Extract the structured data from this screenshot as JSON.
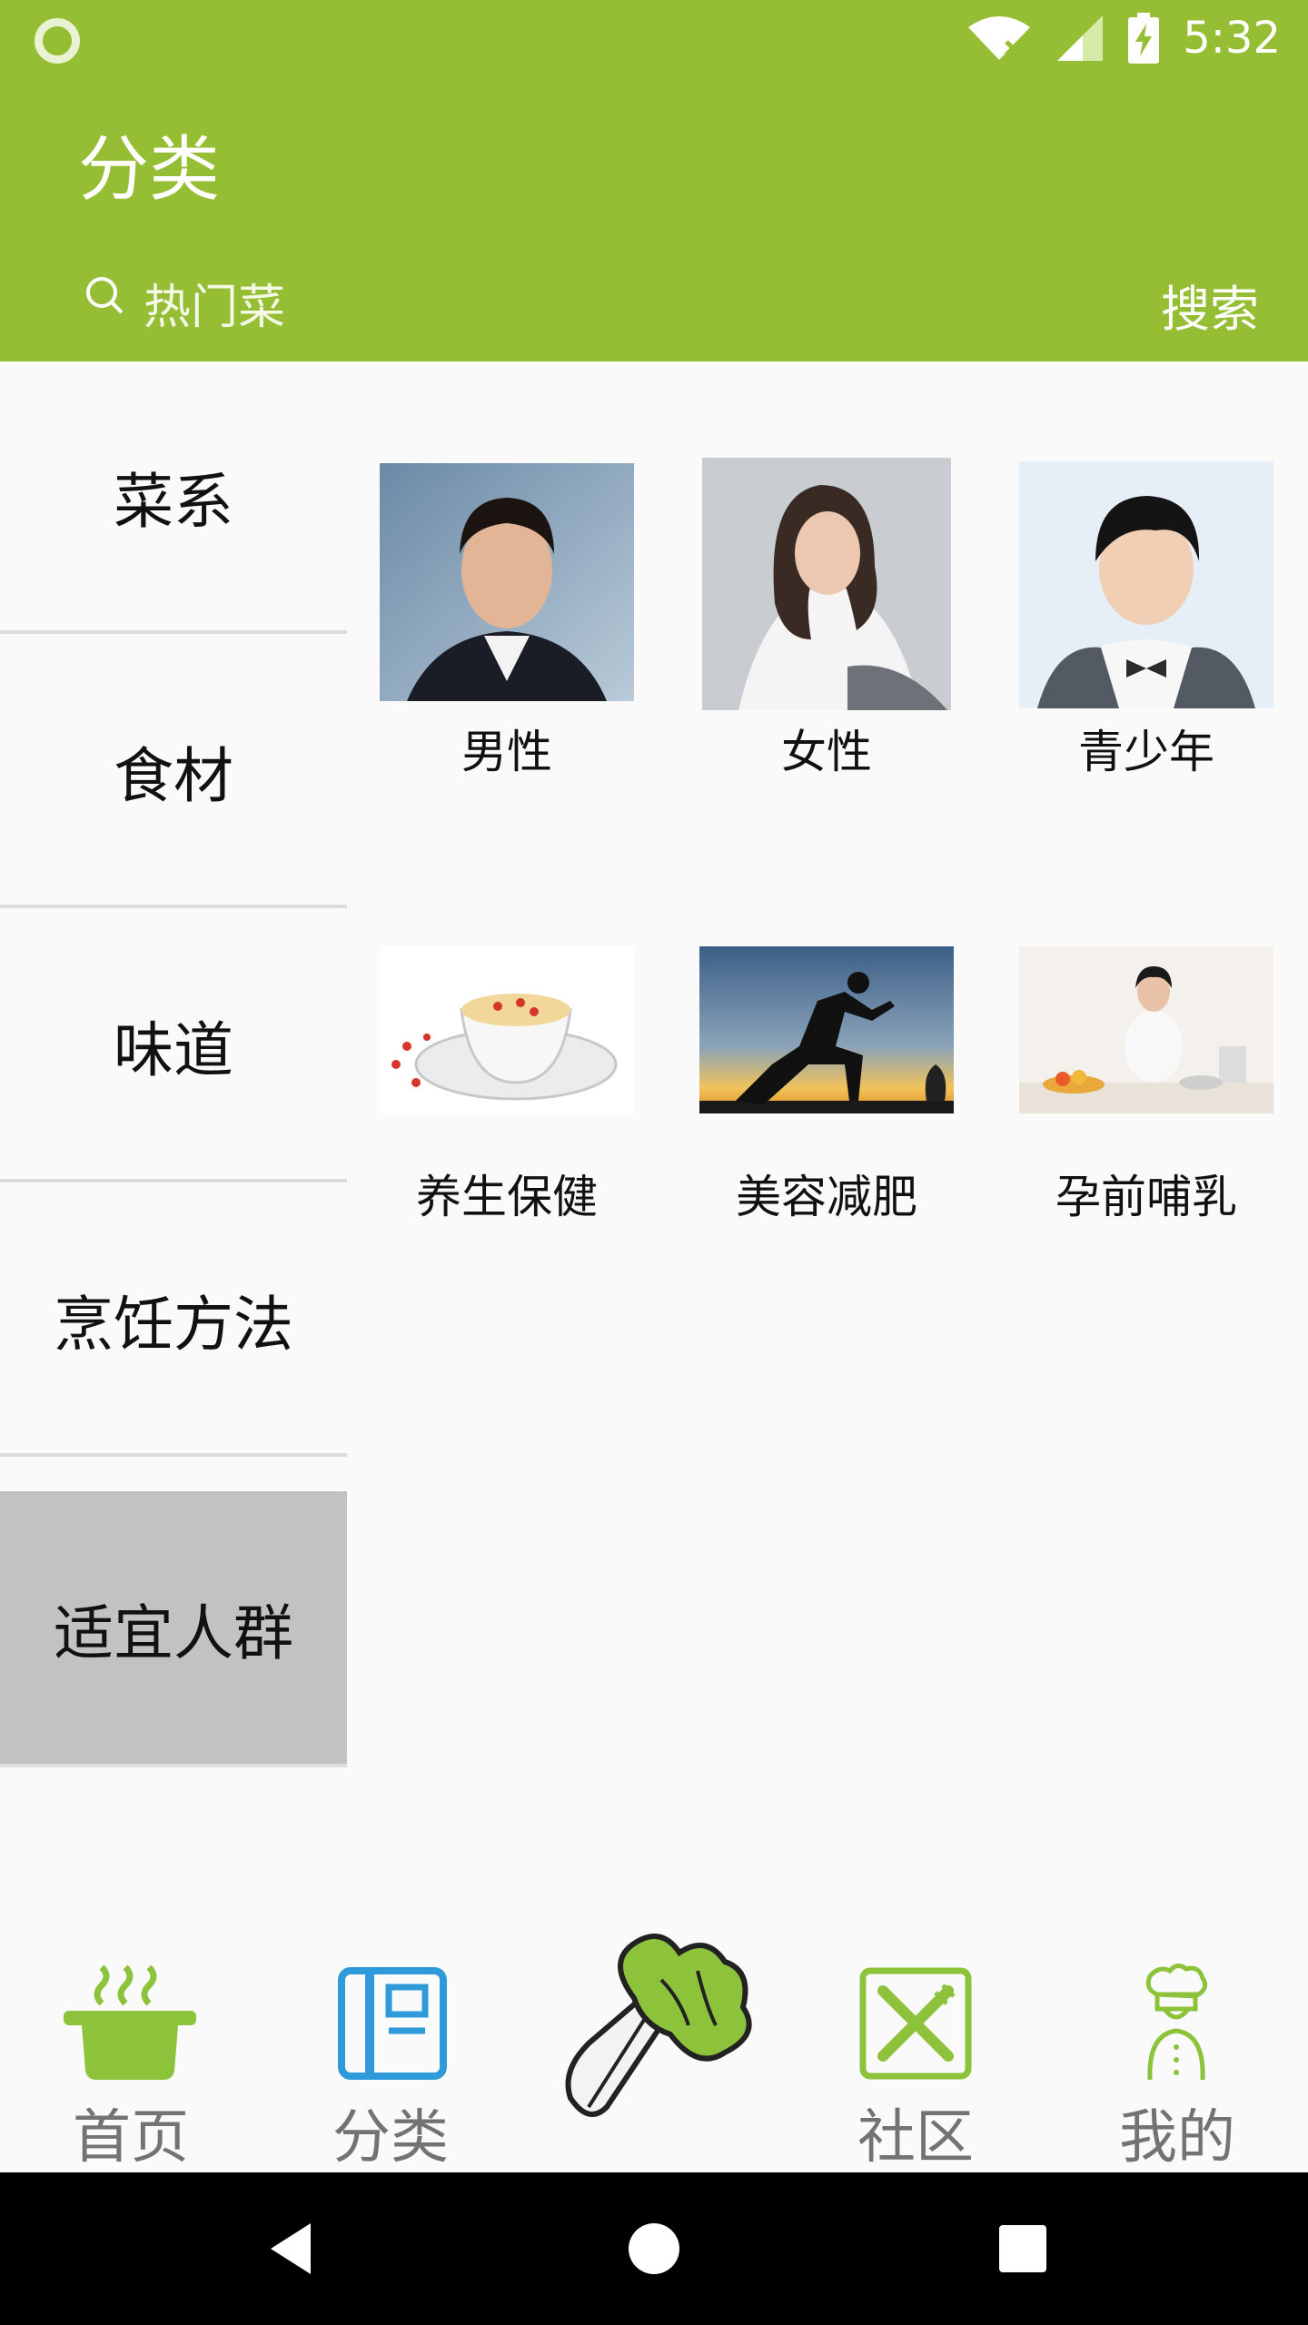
{
  "status_bar": {
    "time": "5:32",
    "icons": [
      "app-notification-icon",
      "wifi-icon",
      "signal-icon",
      "battery-charging-icon"
    ]
  },
  "app_bar": {
    "title": "分类",
    "search_placeholder": "热门菜",
    "search_button": "搜索"
  },
  "sidebar": {
    "items": [
      {
        "label": "菜系",
        "active": false
      },
      {
        "label": "食材",
        "active": false
      },
      {
        "label": "味道",
        "active": false
      },
      {
        "label": "烹饪方法",
        "active": false
      },
      {
        "label": "适宜人群",
        "active": true
      }
    ]
  },
  "grid": {
    "items": [
      {
        "label": "男性",
        "image": "man-portrait"
      },
      {
        "label": "女性",
        "image": "woman-portrait"
      },
      {
        "label": "青少年",
        "image": "teen-portrait"
      },
      {
        "label": "养生保健",
        "image": "tea-cup"
      },
      {
        "label": "美容减肥",
        "image": "runner-silhouette"
      },
      {
        "label": "孕前哺乳",
        "image": "pregnant-woman-kitchen"
      }
    ]
  },
  "bottom_nav": {
    "items": [
      {
        "label": "首页",
        "icon": "pot-icon"
      },
      {
        "label": "分类",
        "icon": "notebook-icon"
      },
      {
        "label": "",
        "icon": "cabbage-icon"
      },
      {
        "label": "社区",
        "icon": "fork-knife-icon"
      },
      {
        "label": "我的",
        "icon": "chef-icon"
      }
    ]
  },
  "colors": {
    "primary": "#95be34",
    "sidebar_active": "#c2c2c2",
    "nav_blue": "#2f9ad9",
    "nav_green": "#8dc33b"
  },
  "system_nav": {
    "buttons": [
      "back-icon",
      "home-icon",
      "recents-icon"
    ]
  }
}
